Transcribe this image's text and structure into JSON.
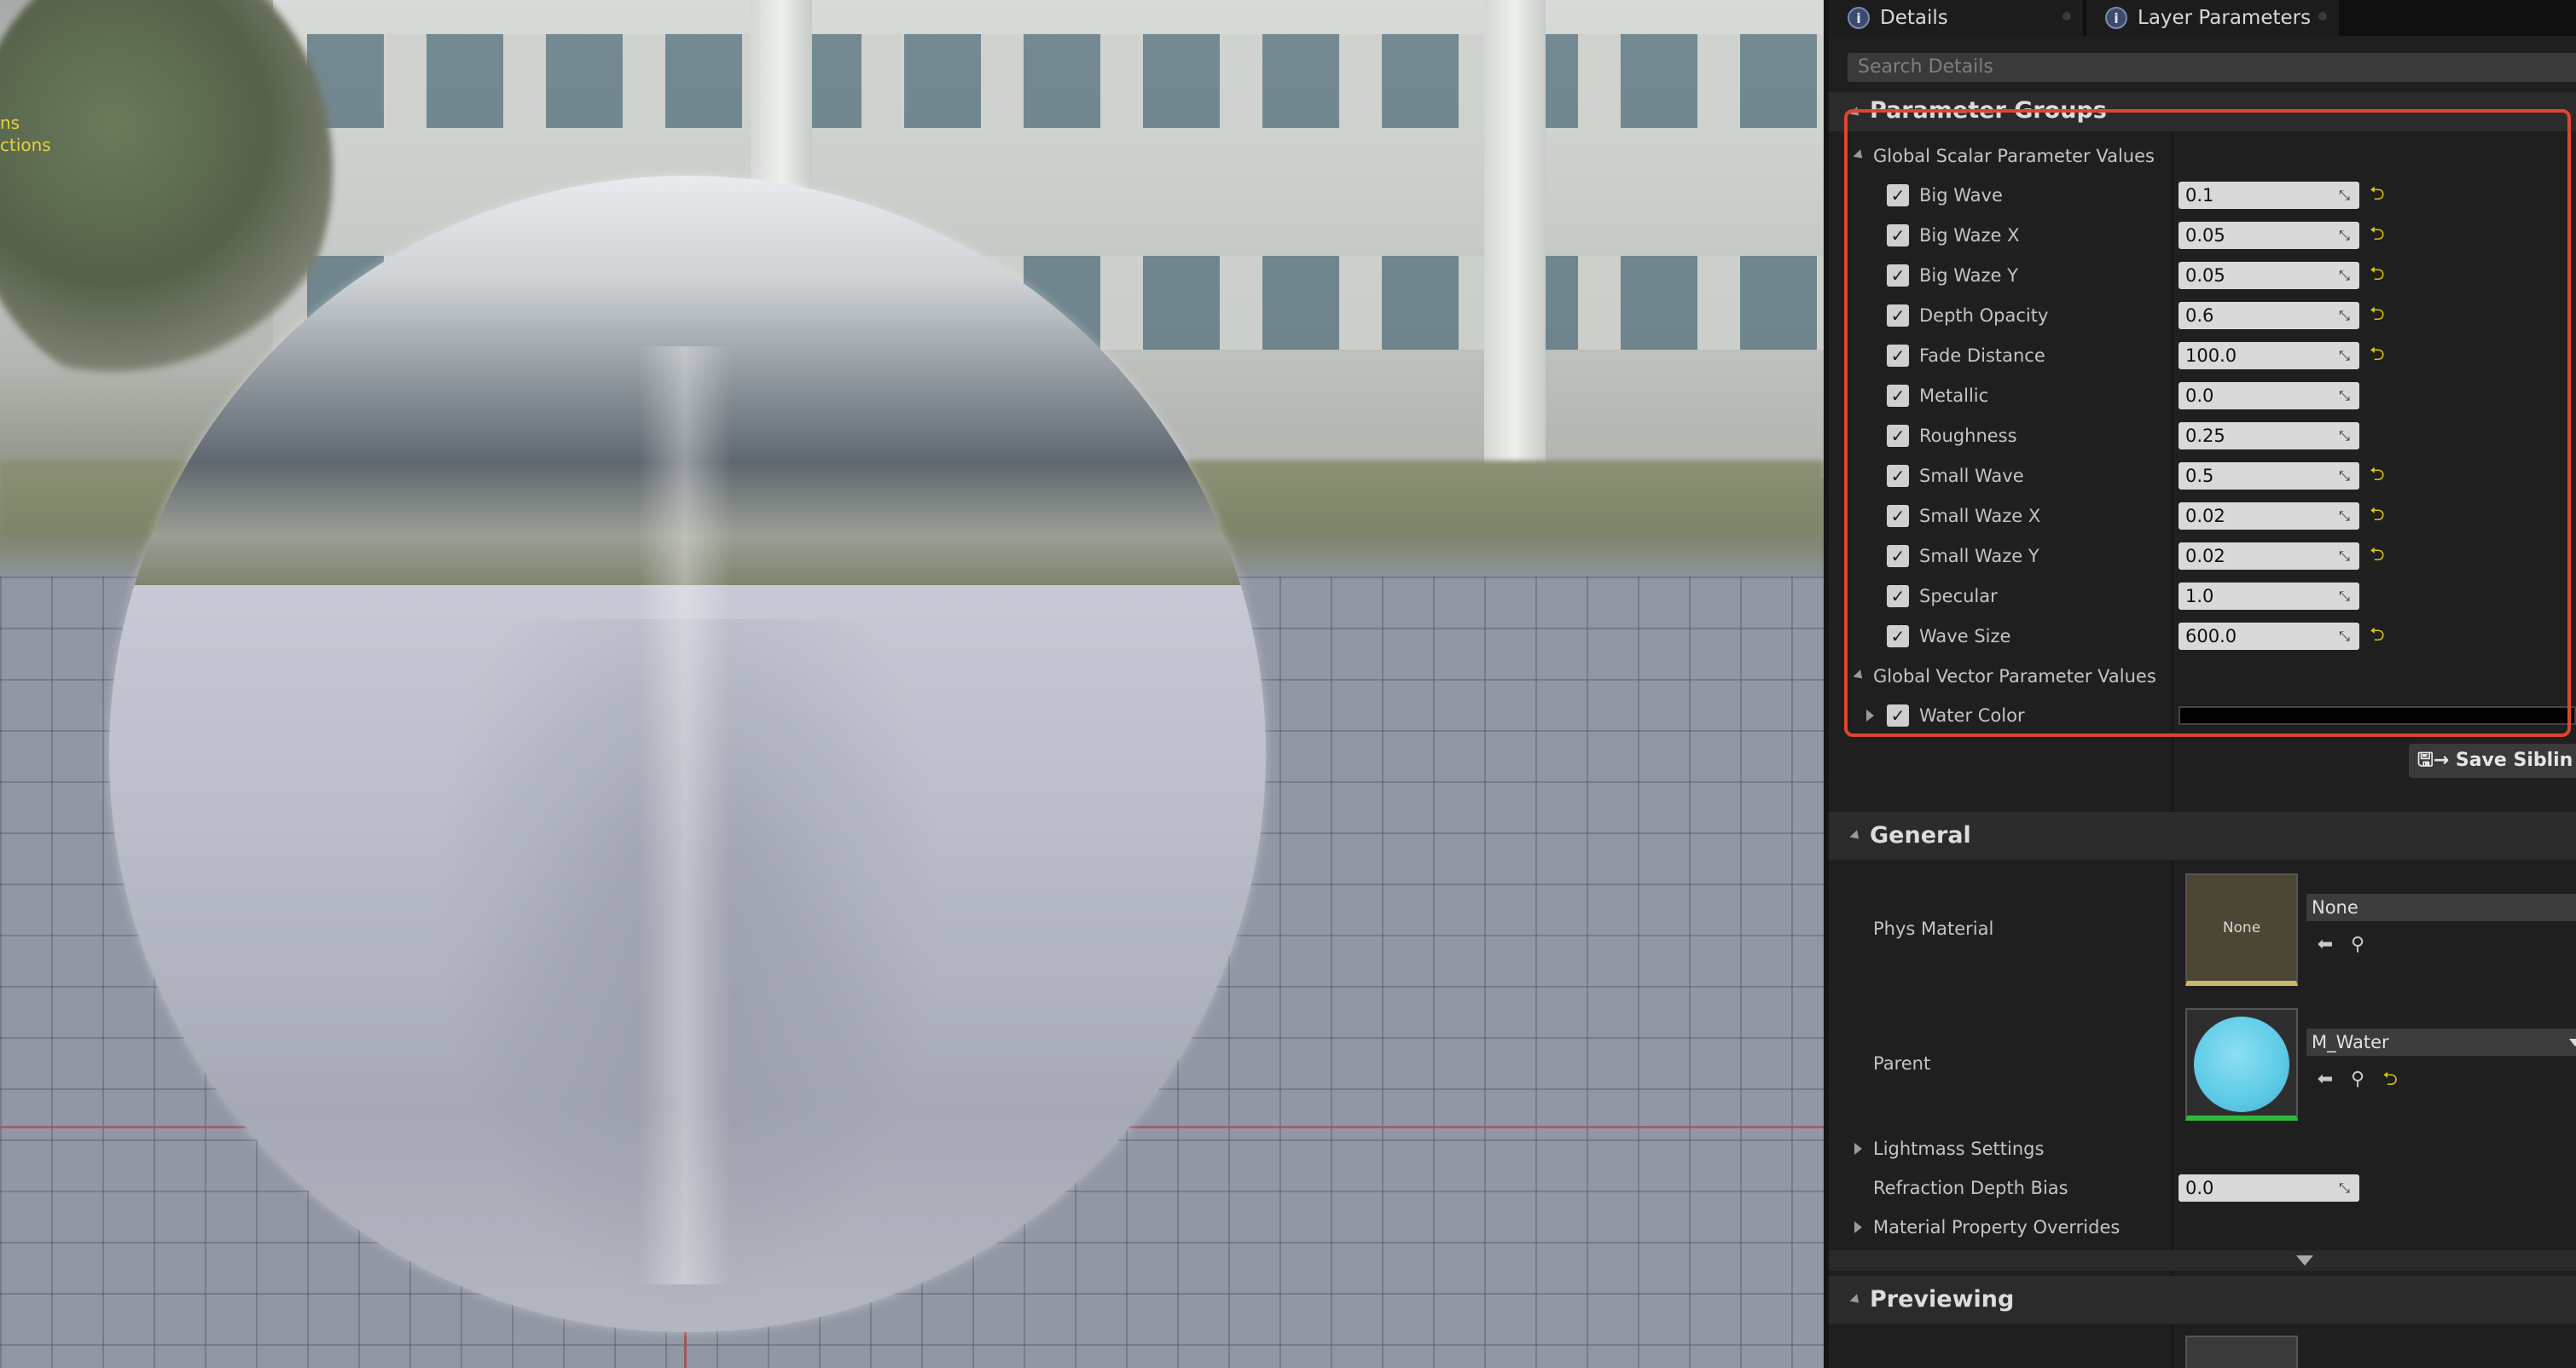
{
  "viewport": {
    "overlay_lines": [
      "ns",
      "ctions"
    ]
  },
  "tabs": [
    {
      "label": "Details",
      "icon": "info-icon"
    },
    {
      "label": "Layer Parameters",
      "icon": "info-icon"
    }
  ],
  "search": {
    "placeholder": "Search Details"
  },
  "parameter_groups": {
    "title": "Parameter Groups",
    "scalar_group": {
      "label": "Global Scalar Parameter Values",
      "params": [
        {
          "name": "Big Wave",
          "value": "0.1",
          "overridden": true
        },
        {
          "name": "Big Waze X",
          "value": "0.05",
          "overridden": true
        },
        {
          "name": "Big Waze Y",
          "value": "0.05",
          "overridden": true
        },
        {
          "name": "Depth Opacity",
          "value": "0.6",
          "overridden": true
        },
        {
          "name": "Fade Distance",
          "value": "100.0",
          "overridden": true
        },
        {
          "name": "Metallic",
          "value": "0.0",
          "overridden": false
        },
        {
          "name": "Roughness",
          "value": "0.25",
          "overridden": false
        },
        {
          "name": "Small Wave",
          "value": "0.5",
          "overridden": true
        },
        {
          "name": "Small Waze X",
          "value": "0.02",
          "overridden": true
        },
        {
          "name": "Small Waze Y",
          "value": "0.02",
          "overridden": true
        },
        {
          "name": "Specular",
          "value": "1.0",
          "overridden": false
        },
        {
          "name": "Wave Size",
          "value": "600.0",
          "overridden": true
        }
      ]
    },
    "vector_group": {
      "label": "Global Vector Parameter Values",
      "params": [
        {
          "name": "Water Color",
          "color": "#000000"
        }
      ]
    }
  },
  "save_button": {
    "label": "Save Siblin"
  },
  "general": {
    "title": "General",
    "phys_material": {
      "label": "Phys Material",
      "thumb_text": "None",
      "value": "None"
    },
    "parent": {
      "label": "Parent",
      "value": "M_Water"
    },
    "lightmass_settings": {
      "label": "Lightmass Settings"
    },
    "refraction_depth_bias": {
      "label": "Refraction Depth Bias",
      "value": "0.0"
    },
    "material_property_overrides": {
      "label": "Material Property Overrides"
    }
  },
  "previewing": {
    "title": "Previewing"
  },
  "colors": {
    "highlight": "#e0442d",
    "reset_arrow": "#d4c516",
    "panel_bg": "#1f1f1f",
    "water_thumb": "#5ccbe7"
  }
}
